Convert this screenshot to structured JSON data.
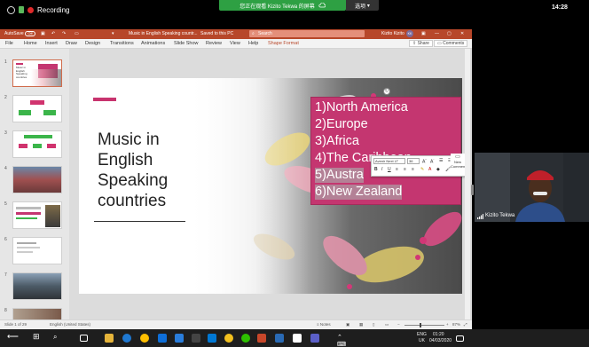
{
  "zoom": {
    "recording_label": "Recording",
    "share_banner": "您正在观看 Kizito Tekwa 的屏幕",
    "options_label": "选项",
    "clock": "14:28"
  },
  "ppt": {
    "autosave": "AutoSave",
    "autosave_state": "Off",
    "doc_title": "Music in English Speaking countr...",
    "saved_status": "Saved to this PC",
    "search_placeholder": "Search",
    "user_name": "Kizito Kizito",
    "user_initials": "KK",
    "menu": [
      "File",
      "Home",
      "Insert",
      "Draw",
      "Design",
      "Transitions",
      "Animations",
      "Slide Show",
      "Review",
      "View",
      "Help",
      "Shape Format"
    ],
    "share_label": "Share",
    "comments_label": "Comments",
    "thumb_numbers": [
      "1",
      "2",
      "3",
      "4",
      "5",
      "6",
      "7",
      "8"
    ],
    "slide": {
      "title": "Music in English Speaking countries",
      "items": [
        "1)North America",
        "2)Europe",
        "3)Africa",
        "4)The Caribbean",
        "5)Austra",
        "6)New Zealand"
      ]
    },
    "mini_toolbar": {
      "font": "Avenir Next LT",
      "size": "36",
      "new_comment": "New Comment"
    },
    "status": {
      "slide_info": "Slide 1 of 29",
      "language": "English (United States)",
      "notes": "Notes",
      "zoom": "87%"
    }
  },
  "video": {
    "participant_name": "Kizito Tekwa"
  },
  "taskbar": {
    "lang": "ENG",
    "region": "UK",
    "time": "01:20",
    "date": "04/03/2020"
  },
  "colors": {
    "ppt_accent": "#b7472a",
    "slide_pink": "#c43670",
    "recording_red": "#e02a2a",
    "share_green": "#2ea043"
  }
}
